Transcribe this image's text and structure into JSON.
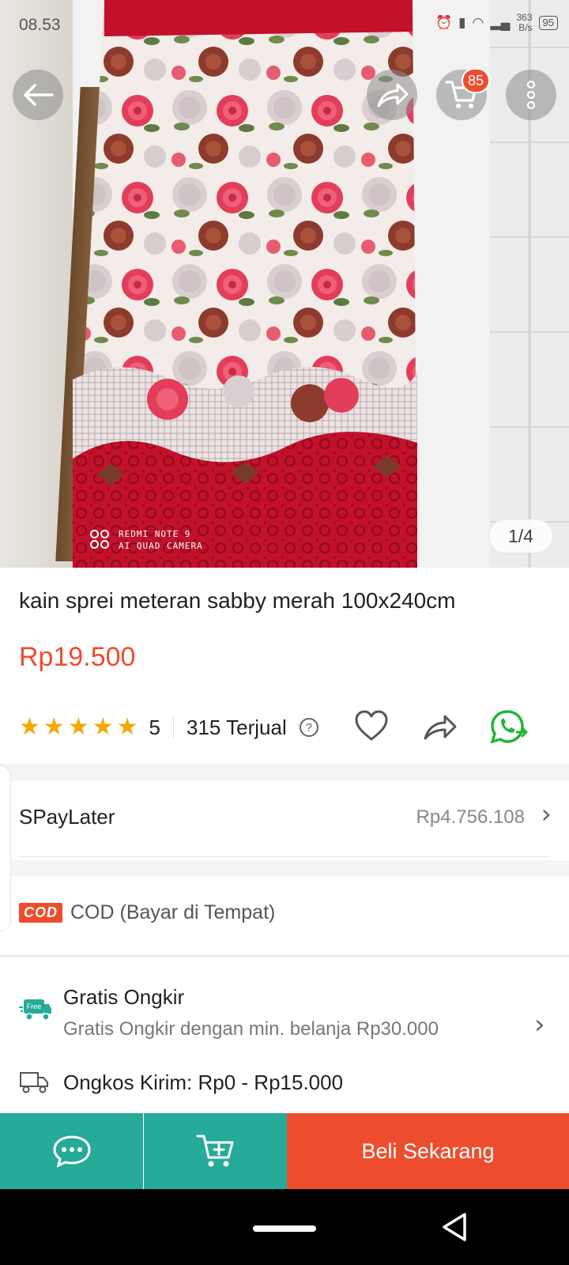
{
  "status_bar": {
    "time": "08.53",
    "speed_top": "363",
    "speed_bottom": "B/s",
    "battery": "95"
  },
  "top_bar": {
    "cart_count": "85"
  },
  "gallery": {
    "counter": "1/4",
    "watermark_line1": "REDMI NOTE 9",
    "watermark_line2": "AI QUAD CAMERA"
  },
  "product": {
    "title": "kain sprei meteran sabby merah 100x240cm",
    "price": "Rp19.500",
    "rating_value": "5",
    "stars": 5,
    "sold": "315 Terjual"
  },
  "spaylater": {
    "label": "SPayLater",
    "value": "Rp4.756.108"
  },
  "cod": {
    "tag": "COD",
    "text": "COD (Bayar di Tempat)"
  },
  "shipping": {
    "free_badge": "Free",
    "free_title": "Gratis Ongkir",
    "free_desc": "Gratis Ongkir dengan min. belanja Rp30.000",
    "cost": "Ongkos Kirim: Rp0 - Rp15.000"
  },
  "bottom_bar": {
    "buy_label": "Beli Sekarang"
  },
  "colors": {
    "accent": "#ee4d2d",
    "teal": "#26aa99",
    "star": "#f6a700",
    "whatsapp": "#25b43b"
  },
  "icons": [
    "back-arrow-icon",
    "share-icon",
    "cart-icon",
    "more-vertical-icon",
    "star-icon",
    "help-icon",
    "heart-icon",
    "share-icon",
    "whatsapp-icon",
    "chevron-right-icon",
    "free-shipping-truck-icon",
    "truck-icon",
    "chat-icon",
    "add-to-cart-icon",
    "nav-back-icon"
  ]
}
